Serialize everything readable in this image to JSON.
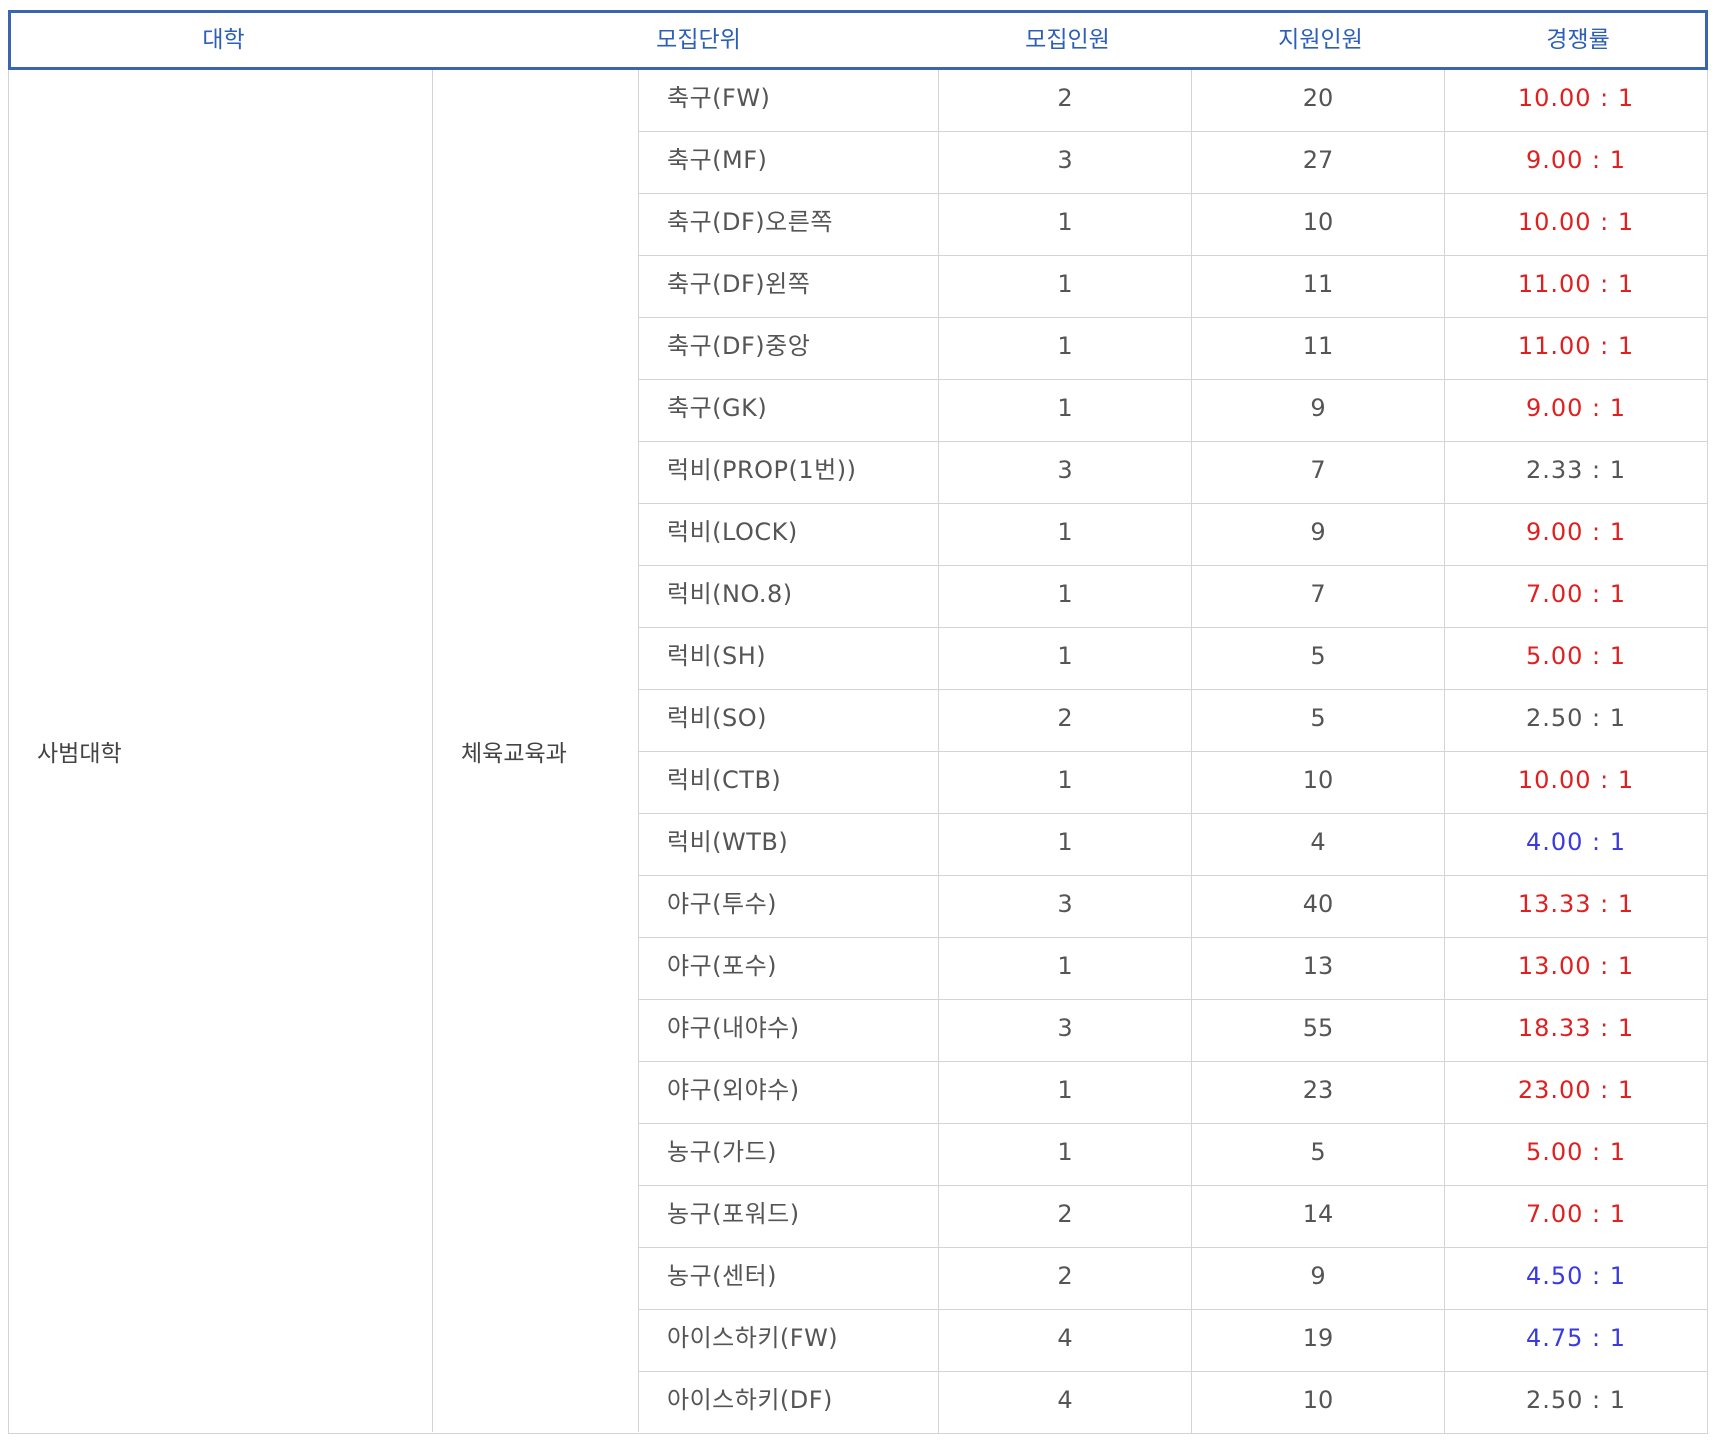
{
  "header": {
    "college": "대학",
    "unit": "모집단위",
    "quota": "모집인원",
    "applicants": "지원인원",
    "ratio": "경쟁률"
  },
  "college": "사범대학",
  "department": "체육교육과",
  "colors": {
    "high": "#e02020",
    "mid": "#3a3ae0",
    "low": "#555555",
    "header": "#2d5fb8"
  },
  "rows": [
    {
      "unit": "축구(FW)",
      "quota": "2",
      "applicants": "20",
      "ratio": "10.00 : 1",
      "level": "high"
    },
    {
      "unit": "축구(MF)",
      "quota": "3",
      "applicants": "27",
      "ratio": "9.00 : 1",
      "level": "high"
    },
    {
      "unit": "축구(DF)오른쪽",
      "quota": "1",
      "applicants": "10",
      "ratio": "10.00 : 1",
      "level": "high"
    },
    {
      "unit": "축구(DF)왼쪽",
      "quota": "1",
      "applicants": "11",
      "ratio": "11.00 : 1",
      "level": "high"
    },
    {
      "unit": "축구(DF)중앙",
      "quota": "1",
      "applicants": "11",
      "ratio": "11.00 : 1",
      "level": "high"
    },
    {
      "unit": "축구(GK)",
      "quota": "1",
      "applicants": "9",
      "ratio": "9.00 : 1",
      "level": "high"
    },
    {
      "unit": "럭비(PROP(1번))",
      "quota": "3",
      "applicants": "7",
      "ratio": "2.33 : 1",
      "level": "low"
    },
    {
      "unit": "럭비(LOCK)",
      "quota": "1",
      "applicants": "9",
      "ratio": "9.00 : 1",
      "level": "high"
    },
    {
      "unit": "럭비(NO.8)",
      "quota": "1",
      "applicants": "7",
      "ratio": "7.00 : 1",
      "level": "high"
    },
    {
      "unit": "럭비(SH)",
      "quota": "1",
      "applicants": "5",
      "ratio": "5.00 : 1",
      "level": "high"
    },
    {
      "unit": "럭비(SO)",
      "quota": "2",
      "applicants": "5",
      "ratio": "2.50 : 1",
      "level": "low"
    },
    {
      "unit": "럭비(CTB)",
      "quota": "1",
      "applicants": "10",
      "ratio": "10.00 : 1",
      "level": "high"
    },
    {
      "unit": "럭비(WTB)",
      "quota": "1",
      "applicants": "4",
      "ratio": "4.00 : 1",
      "level": "mid"
    },
    {
      "unit": "야구(투수)",
      "quota": "3",
      "applicants": "40",
      "ratio": "13.33 : 1",
      "level": "high"
    },
    {
      "unit": "야구(포수)",
      "quota": "1",
      "applicants": "13",
      "ratio": "13.00 : 1",
      "level": "high"
    },
    {
      "unit": "야구(내야수)",
      "quota": "3",
      "applicants": "55",
      "ratio": "18.33 : 1",
      "level": "high"
    },
    {
      "unit": "야구(외야수)",
      "quota": "1",
      "applicants": "23",
      "ratio": "23.00 : 1",
      "level": "high"
    },
    {
      "unit": "농구(가드)",
      "quota": "1",
      "applicants": "5",
      "ratio": "5.00 : 1",
      "level": "high"
    },
    {
      "unit": "농구(포워드)",
      "quota": "2",
      "applicants": "14",
      "ratio": "7.00 : 1",
      "level": "high"
    },
    {
      "unit": "농구(센터)",
      "quota": "2",
      "applicants": "9",
      "ratio": "4.50 : 1",
      "level": "mid"
    },
    {
      "unit": "아이스하키(FW)",
      "quota": "4",
      "applicants": "19",
      "ratio": "4.75 : 1",
      "level": "mid"
    },
    {
      "unit": "아이스하키(DF)",
      "quota": "4",
      "applicants": "10",
      "ratio": "2.50 : 1",
      "level": "low"
    }
  ]
}
